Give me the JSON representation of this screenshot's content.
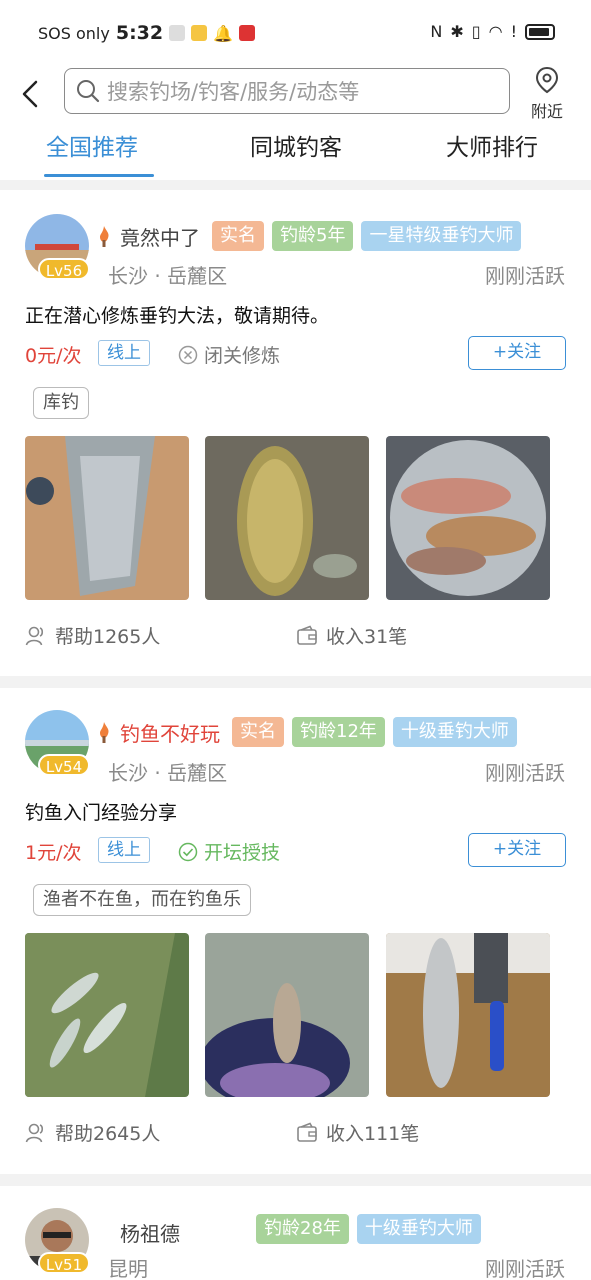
{
  "status_bar": {
    "carrier": "SOS only",
    "time": "5:32"
  },
  "header": {
    "search_placeholder": "搜索钓场/钓客/服务/动态等",
    "nearby_label": "附近"
  },
  "tabs": [
    {
      "label": "全国推荐",
      "active": true
    },
    {
      "label": "同城钓客",
      "active": false
    },
    {
      "label": "大师排行",
      "active": false
    }
  ],
  "cards": [
    {
      "level": "Lv56",
      "name": "竟然中了",
      "tags": {
        "real": "实名",
        "age": "钓龄5年",
        "master": "一星特级垂钓大师"
      },
      "location": "长沙 · 岳麓区",
      "active": "刚刚活跃",
      "intro": "正在潜心修炼垂钓大法，敬请期待。",
      "price": "0元/次",
      "mode": "线上",
      "status": "闭关修炼",
      "follow": "+关注",
      "topic": "库钓",
      "help": "帮助1265人",
      "income": "收入31笔"
    },
    {
      "level": "Lv54",
      "name": "钓鱼不好玩",
      "tags": {
        "real": "实名",
        "age": "钓龄12年",
        "master": "十级垂钓大师"
      },
      "location": "长沙 · 岳麓区",
      "active": "刚刚活跃",
      "intro": "钓鱼入门经验分享",
      "price": "1元/次",
      "mode": "线上",
      "status": "开坛授技",
      "follow": "+关注",
      "topic": "渔者不在鱼，而在钓鱼乐",
      "help": "帮助2645人",
      "income": "收入111笔"
    },
    {
      "level": "Lv51",
      "name": "杨祖德",
      "tags": {
        "age": "钓龄28年",
        "master": "十级垂钓大师"
      },
      "location": "昆明",
      "active": "刚刚活跃"
    }
  ],
  "colors": {
    "accent": "#3b8fd6",
    "price": "#e0443a",
    "level": "#f0b92c"
  }
}
